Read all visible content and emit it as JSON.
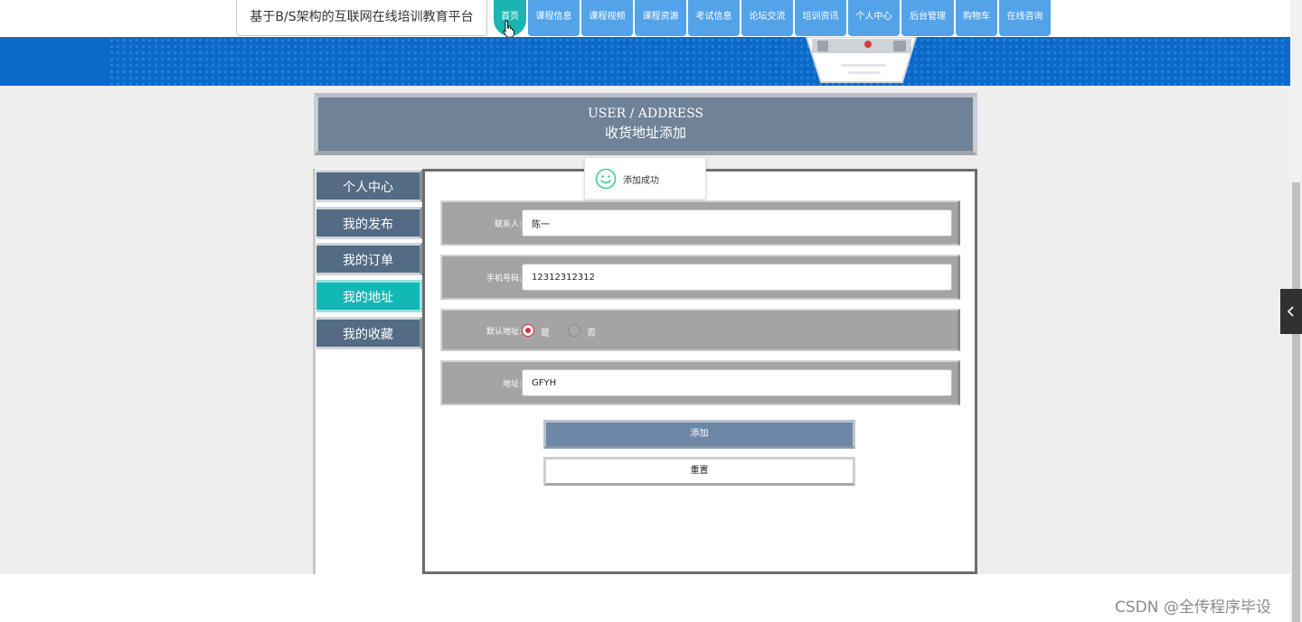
{
  "header": {
    "site_title": "基于B/S架构的互联网在线培训教育平台",
    "nav": [
      {
        "label": "首页",
        "active": true
      },
      {
        "label": "课程信息"
      },
      {
        "label": "课程视频"
      },
      {
        "label": "课程资源"
      },
      {
        "label": "考试信息"
      },
      {
        "label": "论坛交流"
      },
      {
        "label": "培训资讯"
      },
      {
        "label": "个人中心"
      },
      {
        "label": "后台管理"
      },
      {
        "label": "购物车"
      },
      {
        "label": "在线咨询"
      }
    ]
  },
  "section": {
    "title_en": "USER / ADDRESS",
    "title_cn": "收货地址添加"
  },
  "sidebar": {
    "items": [
      {
        "label": "个人中心"
      },
      {
        "label": "我的发布"
      },
      {
        "label": "我的订单"
      },
      {
        "label": "我的地址",
        "active": true
      },
      {
        "label": "我的收藏"
      }
    ]
  },
  "form": {
    "contact_label": "联系人:",
    "contact_value": "陈一",
    "phone_label": "手机号码:",
    "phone_value": "12312312312",
    "default_label": "默认地址:",
    "default_yes": "是",
    "default_no": "否",
    "default_selected": "是",
    "address_label": "地址:",
    "address_value": "GFYH",
    "add_button": "添加",
    "reset_button": "重置"
  },
  "toast": {
    "message": "添加成功"
  },
  "watermark": "CSDN @全传程序毕设",
  "colors": {
    "nav_blue": "#54a3e8",
    "nav_active": "#1ab5b2",
    "banner_blue": "#0b69c9",
    "sidebar_slate": "#536b84",
    "sidebar_active": "#12b8b6",
    "radio_selected": "#e0293c",
    "success_green": "#3ecf8e"
  }
}
